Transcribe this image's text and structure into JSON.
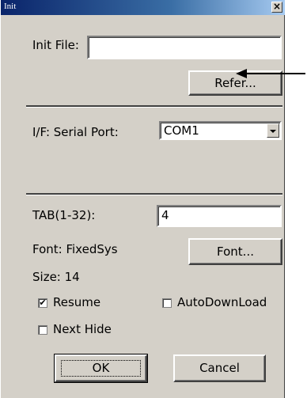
{
  "window": {
    "title": "Init",
    "close_glyph": "×"
  },
  "init_file": {
    "label": "Init File:",
    "value": "",
    "refer_button": "Refer..."
  },
  "interface": {
    "label": "I/F: Serial Port:",
    "selected": "COM1"
  },
  "tab": {
    "label": "TAB(1-32):",
    "value": "4"
  },
  "font": {
    "name_label": "Font: FixedSys",
    "size_label": "Size:  14",
    "button": "Font..."
  },
  "options": {
    "resume": {
      "label": "Resume",
      "checked": true
    },
    "auto_download": {
      "label": "AutoDownLoad",
      "checked": false
    },
    "next_hide": {
      "label": "Next Hide",
      "checked": false
    }
  },
  "buttons": {
    "ok": "OK",
    "cancel": "Cancel"
  },
  "check_glyph": "✔"
}
